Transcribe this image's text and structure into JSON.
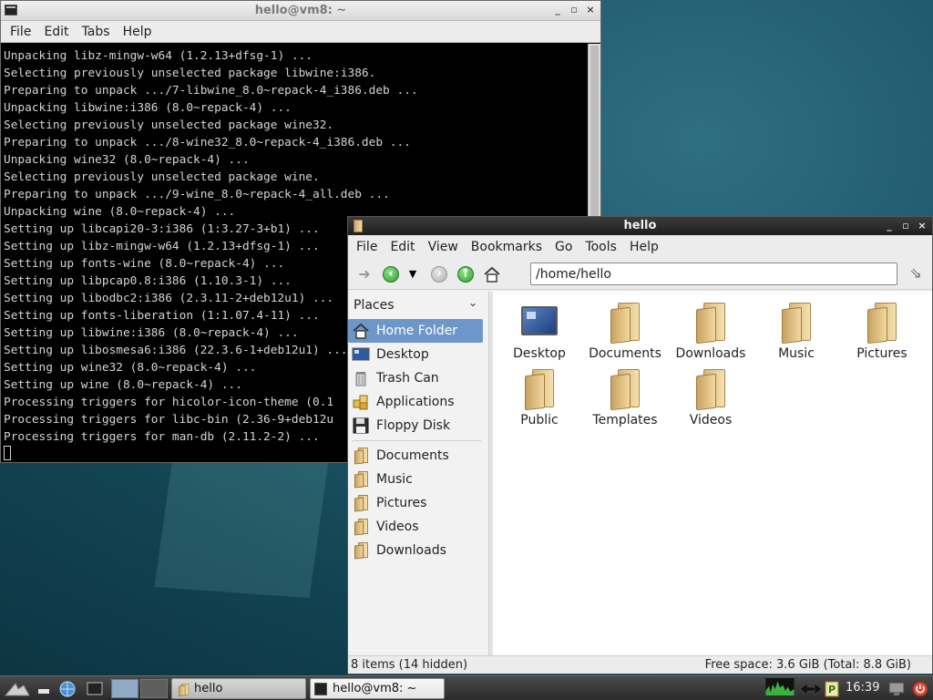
{
  "terminal": {
    "title": "hello@vm8: ~",
    "menu": [
      "File",
      "Edit",
      "Tabs",
      "Help"
    ],
    "lines": [
      "Unpacking libz-mingw-w64 (1.2.13+dfsg-1) ...",
      "Selecting previously unselected package libwine:i386.",
      "Preparing to unpack .../7-libwine_8.0~repack-4_i386.deb ...",
      "Unpacking libwine:i386 (8.0~repack-4) ...",
      "Selecting previously unselected package wine32.",
      "Preparing to unpack .../8-wine32_8.0~repack-4_i386.deb ...",
      "Unpacking wine32 (8.0~repack-4) ...",
      "Selecting previously unselected package wine.",
      "Preparing to unpack .../9-wine_8.0~repack-4_all.deb ...",
      "Unpacking wine (8.0~repack-4) ...",
      "Setting up libcapi20-3:i386 (1:3.27-3+b1) ...",
      "Setting up libz-mingw-w64 (1.2.13+dfsg-1) ...",
      "Setting up fonts-wine (8.0~repack-4) ...",
      "Setting up libpcap0.8:i386 (1.10.3-1) ...",
      "Setting up libodbc2:i386 (2.3.11-2+deb12u1) ...",
      "Setting up fonts-liberation (1:1.07.4-11) ...",
      "Setting up libwine:i386 (8.0~repack-4) ...",
      "Setting up libosmesa6:i386 (22.3.6-1+deb12u1) ...",
      "Setting up wine32 (8.0~repack-4) ...",
      "Setting up wine (8.0~repack-4) ...",
      "Processing triggers for hicolor-icon-theme (0.1",
      "Processing triggers for libc-bin (2.36-9+deb12u",
      "Processing triggers for man-db (2.11.2-2) ..."
    ]
  },
  "filemanager": {
    "title": "hello",
    "menu": [
      "File",
      "Edit",
      "View",
      "Bookmarks",
      "Go",
      "Tools",
      "Help"
    ],
    "path": "/home/hello",
    "places_label": "Places",
    "places": [
      {
        "label": "Home Folder",
        "icon": "home-icon",
        "selected": true
      },
      {
        "label": "Desktop",
        "icon": "desktop-icon"
      },
      {
        "label": "Trash Can",
        "icon": "trash-icon"
      },
      {
        "label": "Applications",
        "icon": "applications-icon"
      },
      {
        "label": "Floppy Disk",
        "icon": "floppy-icon"
      }
    ],
    "bookmarks": [
      {
        "label": "Documents",
        "icon": "folder-icon"
      },
      {
        "label": "Music",
        "icon": "folder-icon"
      },
      {
        "label": "Pictures",
        "icon": "folder-icon"
      },
      {
        "label": "Videos",
        "icon": "folder-icon"
      },
      {
        "label": "Downloads",
        "icon": "folder-icon"
      }
    ],
    "items": [
      {
        "label": "Desktop",
        "icon": "desktop-icon"
      },
      {
        "label": "Documents",
        "icon": "folder-icon"
      },
      {
        "label": "Downloads",
        "icon": "folder-icon"
      },
      {
        "label": "Music",
        "icon": "folder-icon"
      },
      {
        "label": "Pictures",
        "icon": "folder-icon"
      },
      {
        "label": "Public",
        "icon": "folder-icon"
      },
      {
        "label": "Templates",
        "icon": "folder-icon"
      },
      {
        "label": "Videos",
        "icon": "folder-icon"
      }
    ],
    "status_left": "8 items (14 hidden)",
    "status_right": "Free space: 3.6 GiB (Total: 8.8 GiB)"
  },
  "taskbar": {
    "tasks": [
      {
        "label": "hello",
        "icon": "folder-icon",
        "active": false
      },
      {
        "label": "hello@vm8: ~",
        "icon": "terminal-icon",
        "active": true
      }
    ],
    "clock": "16:39"
  }
}
